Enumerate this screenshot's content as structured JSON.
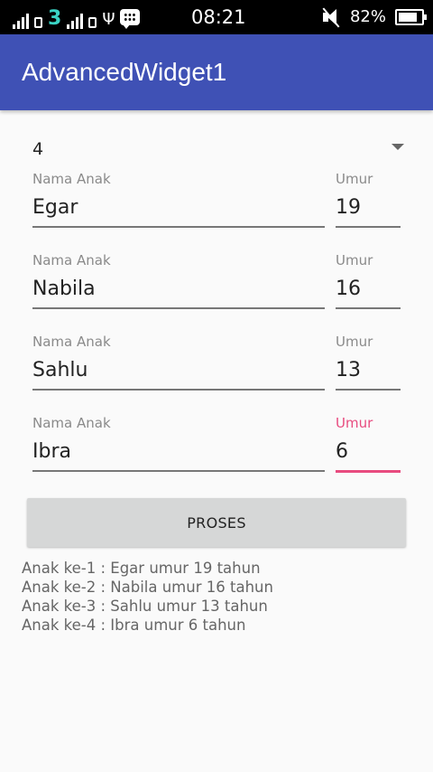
{
  "status_bar": {
    "network_label": "3",
    "time": "08:21",
    "battery_percent": "82%",
    "battery_level": 0.82,
    "icons": [
      "signal-icon",
      "sim-icon",
      "signal-icon",
      "sd-card-icon",
      "usb-icon",
      "bbm-icon",
      "mute-icon",
      "battery-icon"
    ]
  },
  "app_bar": {
    "title": "AdvancedWidget1",
    "color": "#3f51b5"
  },
  "spinner": {
    "selected_value": "4"
  },
  "children": [
    {
      "name_label": "Nama Anak",
      "name_value": "Egar",
      "age_label": "Umur",
      "age_value": "19"
    },
    {
      "name_label": "Nama Anak",
      "name_value": "Nabila",
      "age_label": "Umur",
      "age_value": "16"
    },
    {
      "name_label": "Nama Anak",
      "name_value": "Sahlu",
      "age_label": "Umur",
      "age_value": "13"
    },
    {
      "name_label": "Nama Anak",
      "name_value": "Ibra",
      "age_label": "Umur",
      "age_value": "6"
    }
  ],
  "focused_field": "children.3.age",
  "accent_color": "#e84b7f",
  "button": {
    "label": "PROSES"
  },
  "results": [
    "Anak ke-1 : Egar umur 19 tahun",
    "Anak ke-2 : Nabila umur 16 tahun",
    "Anak ke-3 : Sahlu umur 13 tahun",
    "Anak ke-4 : Ibra umur 6 tahun"
  ]
}
